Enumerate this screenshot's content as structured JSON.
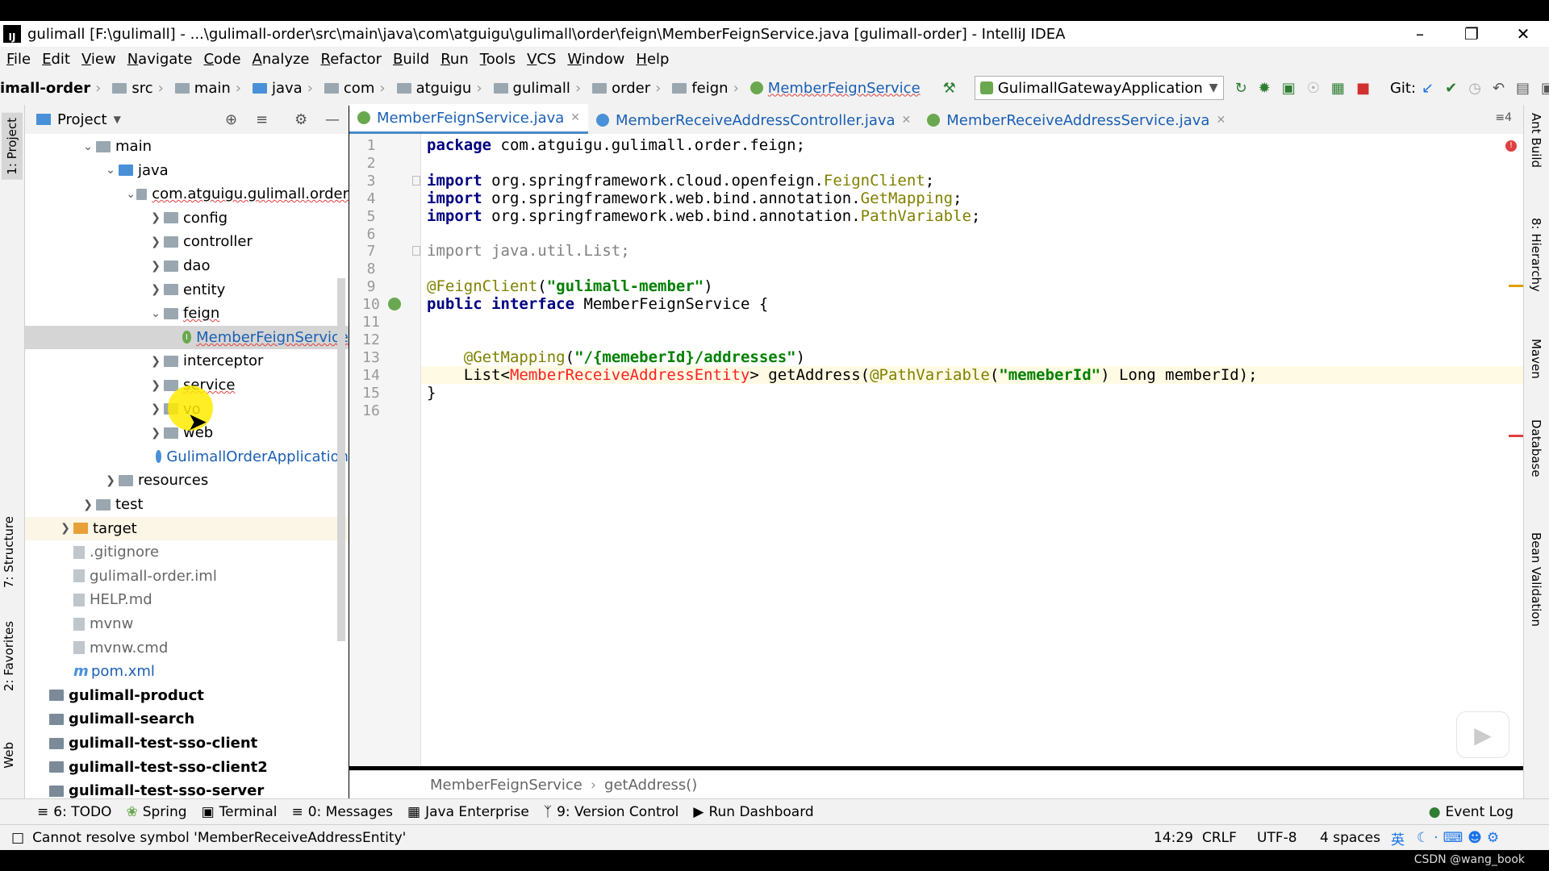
{
  "window": {
    "title": "gulimall [F:\\gulimall] - ...\\gulimall-order\\src\\main\\java\\com\\atguigu\\gulimall\\order\\feign\\MemberFeignService.java [gulimall-order] - IntelliJ IDEA",
    "logo": "IJ"
  },
  "menu": [
    "File",
    "Edit",
    "View",
    "Navigate",
    "Code",
    "Analyze",
    "Refactor",
    "Build",
    "Run",
    "Tools",
    "VCS",
    "Window",
    "Help"
  ],
  "breadcrumbs": [
    "imall-order",
    "src",
    "main",
    "java",
    "com",
    "atguigu",
    "gulimall",
    "order",
    "feign",
    "MemberFeignService"
  ],
  "run_config": "GulimallGatewayApplication",
  "git_label": "Git:",
  "left_tabs": [
    "1: Project",
    "7: Structure",
    "2: Favorites",
    "Web"
  ],
  "right_tabs": [
    "Ant Build",
    "8: Hierarchy",
    "Maven",
    "Database",
    "Bean Validation"
  ],
  "project": {
    "header": "Project",
    "tree": [
      {
        "label": "main",
        "indent": 1,
        "arrow": "down",
        "icon": "folder"
      },
      {
        "label": "java",
        "indent": 2,
        "arrow": "down",
        "icon": "folder-blue"
      },
      {
        "label": "com.atguigu.gulimall.order",
        "indent": 3,
        "arrow": "down",
        "icon": "folder",
        "squig": true
      },
      {
        "label": "config",
        "indent": 4,
        "arrow": "right",
        "icon": "folder"
      },
      {
        "label": "controller",
        "indent": 4,
        "arrow": "right",
        "icon": "folder"
      },
      {
        "label": "dao",
        "indent": 4,
        "arrow": "right",
        "icon": "folder"
      },
      {
        "label": "entity",
        "indent": 4,
        "arrow": "right",
        "icon": "folder"
      },
      {
        "label": "feign",
        "indent": 4,
        "arrow": "down",
        "icon": "folder",
        "squig": true
      },
      {
        "label": "MemberFeignService",
        "indent": 5,
        "arrow": "",
        "icon": "interface",
        "selected": true,
        "squig": true
      },
      {
        "label": "interceptor",
        "indent": 4,
        "arrow": "right",
        "icon": "folder"
      },
      {
        "label": "service",
        "indent": 4,
        "arrow": "right",
        "icon": "folder",
        "squig": true
      },
      {
        "label": "vo",
        "indent": 4,
        "arrow": "right",
        "icon": "folder"
      },
      {
        "label": "web",
        "indent": 4,
        "arrow": "right",
        "icon": "folder"
      },
      {
        "label": "GulimallOrderApplication",
        "indent": 4,
        "arrow": "",
        "icon": "class",
        "link": true
      },
      {
        "label": "resources",
        "indent": 2,
        "arrow": "right",
        "icon": "folder"
      },
      {
        "label": "test",
        "indent": 1,
        "arrow": "right",
        "icon": "folder"
      },
      {
        "label": "target",
        "indent": 0,
        "arrow": "right",
        "icon": "folder-orange",
        "highlight": true
      },
      {
        "label": ".gitignore",
        "indent": 0,
        "arrow": "",
        "icon": "file",
        "muted": true
      },
      {
        "label": "gulimall-order.iml",
        "indent": 0,
        "arrow": "",
        "icon": "file",
        "muted": true
      },
      {
        "label": "HELP.md",
        "indent": 0,
        "arrow": "",
        "icon": "file",
        "muted": true
      },
      {
        "label": "mvnw",
        "indent": 0,
        "arrow": "",
        "icon": "file",
        "muted": true
      },
      {
        "label": "mvnw.cmd",
        "indent": 0,
        "arrow": "",
        "icon": "file",
        "muted": true
      },
      {
        "label": "pom.xml",
        "indent": 0,
        "arrow": "",
        "icon": "maven",
        "link": true
      },
      {
        "label": "gulimall-product",
        "indent": -1,
        "arrow": "",
        "icon": "module",
        "bold": true
      },
      {
        "label": "gulimall-search",
        "indent": -1,
        "arrow": "",
        "icon": "module",
        "bold": true
      },
      {
        "label": "gulimall-test-sso-client",
        "indent": -1,
        "arrow": "",
        "icon": "module",
        "bold": true
      },
      {
        "label": "gulimall-test-sso-client2",
        "indent": -1,
        "arrow": "",
        "icon": "module",
        "bold": true
      },
      {
        "label": "gulimall-test-sso-server",
        "indent": -1,
        "arrow": "",
        "icon": "module",
        "bold": true
      }
    ]
  },
  "tabs": [
    {
      "label": "MemberFeignService.java",
      "active": true,
      "icon": "interface"
    },
    {
      "label": "MemberReceiveAddressController.java",
      "active": false,
      "icon": "class"
    },
    {
      "label": "MemberReceiveAddressService.java",
      "active": false,
      "icon": "interface"
    }
  ],
  "tab_count": "4",
  "code_lines": [
    "package com.atguigu.gulimall.order.feign;",
    "",
    "import org.springframework.cloud.openfeign.FeignClient;",
    "import org.springframework.web.bind.annotation.GetMapping;",
    "import org.springframework.web.bind.annotation.PathVariable;",
    "",
    "import java.util.List;",
    "",
    "@FeignClient(\"gulimall-member\")",
    "public interface MemberFeignService {",
    "",
    "",
    "    @GetMapping(\"/{memeberId}/addresses\")",
    "    List<MemberReceiveAddressEntity> getAddress(@PathVariable(\"memeberId\") Long memberId);",
    "}",
    ""
  ],
  "editor_breadcrumb": [
    "MemberFeignService",
    "getAddress()"
  ],
  "toolwindows": [
    "6: TODO",
    "Spring",
    "Terminal",
    "0: Messages",
    "Java Enterprise",
    "9: Version Control",
    "Run Dashboard"
  ],
  "event_log": "Event Log",
  "status": {
    "message": "Cannot resolve symbol 'MemberReceiveAddressEntity'",
    "position": "14:29",
    "line_sep": "CRLF",
    "encoding": "UTF-8",
    "indent": "4 spaces",
    "ime": "英"
  },
  "watermark": "CSDN @wang_book"
}
